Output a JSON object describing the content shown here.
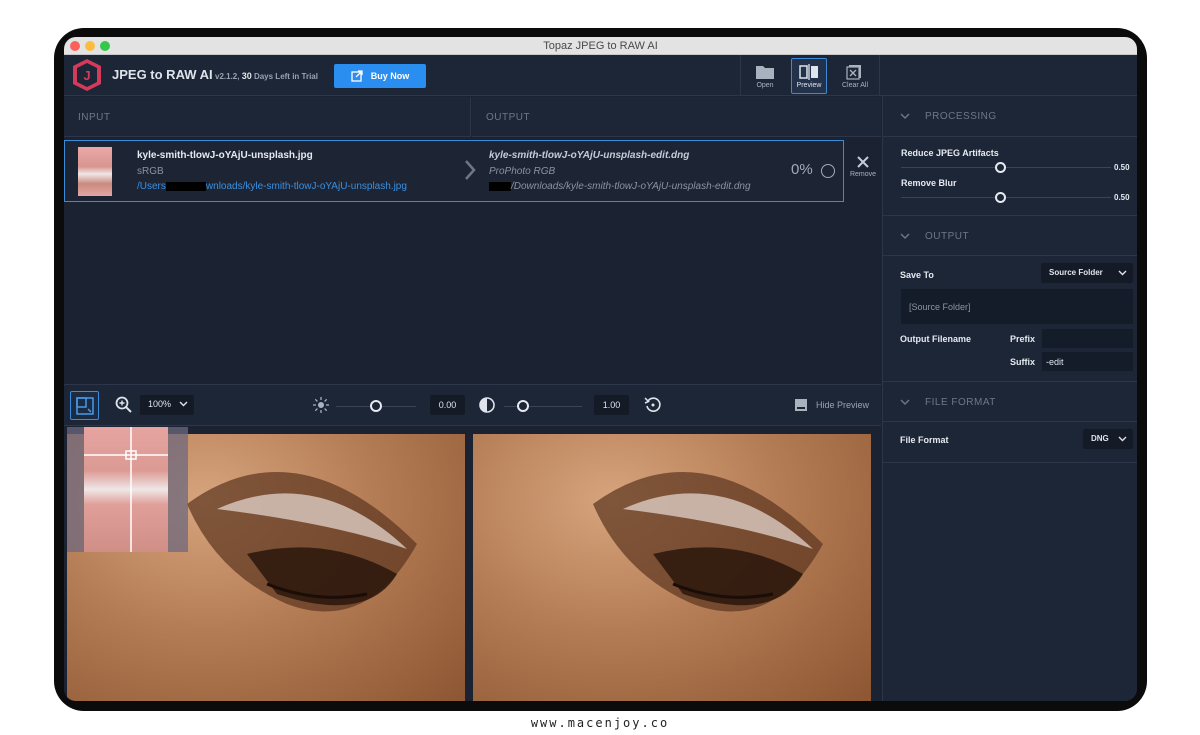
{
  "window": {
    "title": "Topaz JPEG to RAW AI"
  },
  "app": {
    "name": "JPEG to RAW AI",
    "version": "v2.1.2,",
    "trial_days": "30",
    "trial_text": "Days Left in Trial",
    "buy_label": "Buy Now",
    "logo_letter": "J",
    "brand_color": "#d63a5a",
    "accent_color": "#2a8ef0"
  },
  "toolbar": {
    "open_label": "Open",
    "preview_label": "Preview",
    "clear_label": "Clear All"
  },
  "columns": {
    "input": "INPUT",
    "output": "OUTPUT"
  },
  "file": {
    "input_name": "kyle-smith-tlowJ-oYAjU-unsplash.jpg",
    "input_colorspace": "sRGB",
    "input_path_start": "/Users",
    "input_path_end": "wnloads/kyle-smith-tlowJ-oYAjU-unsplash.jpg",
    "output_name": "kyle-smith-tlowJ-oYAjU-unsplash-edit.dng",
    "output_colorspace": "ProPhoto RGB",
    "output_path_end": "/Downloads/kyle-smith-tlowJ-oYAjU-unsplash-edit.dng",
    "progress": "0%",
    "remove_label": "Remove"
  },
  "preview_toolbar": {
    "zoom": "100%",
    "brightness_value": "0.00",
    "brightness_level": 0.5,
    "contrast_value": "1.00",
    "contrast_level": 0.1,
    "hide_preview_label": "Hide Preview"
  },
  "sidebar": {
    "processing": {
      "title": "PROCESSING",
      "reduce_label": "Reduce JPEG Artifacts",
      "reduce_value": "0.50",
      "blur_label": "Remove Blur",
      "blur_value": "0.50"
    },
    "output": {
      "title": "OUTPUT",
      "save_to_label": "Save To",
      "save_to_value": "Source Folder",
      "folder_value": "[Source Folder]",
      "filename_label": "Output Filename",
      "prefix_label": "Prefix",
      "prefix_value": "",
      "suffix_label": "Suffix",
      "suffix_value": "-edit"
    },
    "file_format": {
      "title": "FILE FORMAT",
      "label": "File Format",
      "value": "DNG"
    }
  },
  "caption": "www.macenjoy.co"
}
